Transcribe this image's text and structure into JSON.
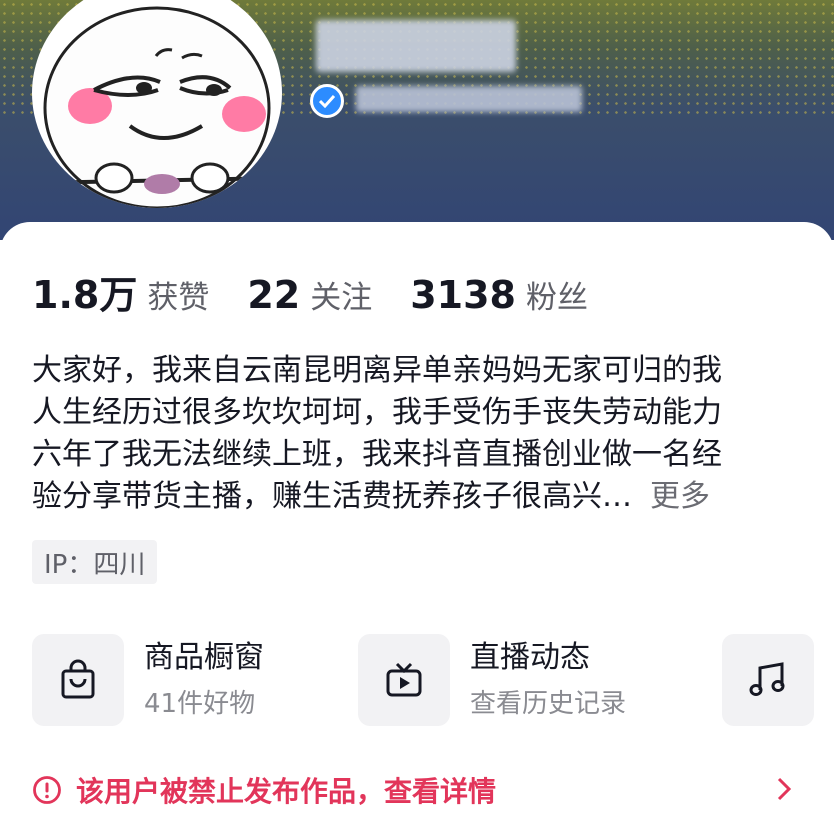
{
  "profile": {
    "name": "████",
    "subtitle": "██████████",
    "verified_icon": "check-circle-icon"
  },
  "stats": [
    {
      "value": "1.8万",
      "label": "获赞"
    },
    {
      "value": "22",
      "label": "关注"
    },
    {
      "value": "3138",
      "label": "粉丝"
    }
  ],
  "bio": {
    "lines": [
      "大家好，我来自云南昆明离异单亲妈妈无家可归的我",
      "人生经历过很多坎坎坷坷，我手受伤手丧失劳动能力",
      "六年了我无法继续上班，我来抖音直播创业做一名经",
      "验分享带货主播，赚生活费抚养孩子很高兴…"
    ],
    "more_label": "更多"
  },
  "ip_tag": "IP：四川",
  "features": [
    {
      "title": "商品橱窗",
      "subtitle": "41件好物",
      "icon": "shopping-bag-icon"
    },
    {
      "title": "直播动态",
      "subtitle": "查看历史记录",
      "icon": "tv-icon"
    },
    {
      "title": "",
      "subtitle": "",
      "icon": "music-note-icon"
    }
  ],
  "notice": {
    "text": "该用户被禁止发布作品，查看详情",
    "color": "#e2355a"
  },
  "colors": {
    "text_primary": "#161823",
    "text_secondary": "#5f6068",
    "verified_blue": "#2c8cff",
    "banner_navy": "#324574"
  }
}
